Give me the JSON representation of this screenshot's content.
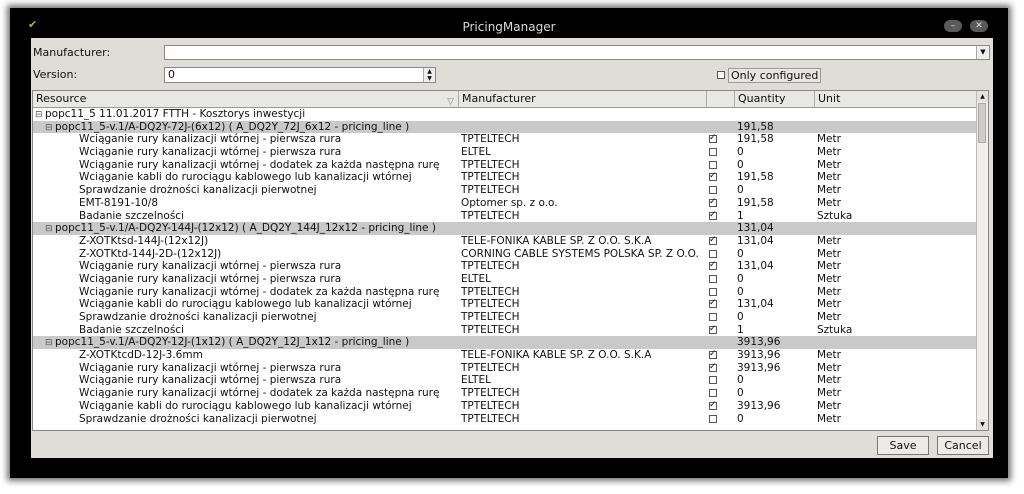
{
  "window": {
    "title": "PricingManager"
  },
  "form": {
    "manufacturer_label": "Manufacturer:",
    "manufacturer_value": "",
    "version_label": "Version:",
    "version_value": "0",
    "only_configured_label": "Only configured",
    "only_configured_checked": false
  },
  "table": {
    "columns": [
      "Resource",
      "Manufacturer",
      "",
      "Quantity",
      "Unit"
    ],
    "rows": [
      {
        "type": "root",
        "resource": "popc11_5  11.01.2017  FTTH - Kosztorys inwestycji",
        "manufacturer": "",
        "checked": null,
        "quantity": "",
        "unit": ""
      },
      {
        "type": "group",
        "resource": "popc11_5-v.1/A-DQ2Y-72J-(6x12)  ( A_DQ2Y_72J_6x12 - pricing_line )",
        "manufacturer": "",
        "checked": null,
        "quantity": "191,58",
        "unit": ""
      },
      {
        "type": "item",
        "resource": "Wciąganie rury kanalizacji wtórnej - pierwsza rura",
        "manufacturer": "TPTELTECH",
        "checked": true,
        "quantity": "191,58",
        "unit": "Metr"
      },
      {
        "type": "item",
        "resource": "Wciąganie rury kanalizacji wtórnej - pierwsza rura",
        "manufacturer": "ELTEL",
        "checked": false,
        "quantity": "0",
        "unit": "Metr"
      },
      {
        "type": "item",
        "resource": "Wciąganie rury kanalizacji wtórnej - dodatek za każda następna rurę",
        "manufacturer": "TPTELTECH",
        "checked": false,
        "quantity": "0",
        "unit": "Metr"
      },
      {
        "type": "item",
        "resource": "Wciąganie kabli do rurociągu kablowego lub kanalizacji wtórnej",
        "manufacturer": "TPTELTECH",
        "checked": true,
        "quantity": "191,58",
        "unit": "Metr"
      },
      {
        "type": "item",
        "resource": "Sprawdzanie drożności kanalizacji pierwotnej",
        "manufacturer": "TPTELTECH",
        "checked": false,
        "quantity": "0",
        "unit": "Metr"
      },
      {
        "type": "item",
        "resource": "EMT-8191-10/8",
        "manufacturer": "Optomer sp. z o.o.",
        "checked": true,
        "quantity": "191,58",
        "unit": "Metr"
      },
      {
        "type": "item",
        "resource": "Badanie szczelności",
        "manufacturer": "TPTELTECH",
        "checked": true,
        "quantity": "1",
        "unit": "Sztuka"
      },
      {
        "type": "group",
        "resource": "popc11_5-v.1/A-DQ2Y-144J-(12x12)  ( A_DQ2Y_144J_12x12 - pricing_line )",
        "manufacturer": "",
        "checked": null,
        "quantity": "131,04",
        "unit": ""
      },
      {
        "type": "item",
        "resource": "Z-XOTKtsd-144J-(12x12J)",
        "manufacturer": "TELE-FONIKA KABLE SP. Z O.O. S.K.A",
        "checked": true,
        "quantity": "131,04",
        "unit": "Metr"
      },
      {
        "type": "item",
        "resource": "Z-XOTKtd-144J-2D-(12x12J)",
        "manufacturer": "CORNING CABLE SYSTEMS POLSKA SP. Z O.O.",
        "checked": false,
        "quantity": "0",
        "unit": "Metr"
      },
      {
        "type": "item",
        "resource": "Wciąganie rury kanalizacji wtórnej - pierwsza rura",
        "manufacturer": "TPTELTECH",
        "checked": true,
        "quantity": "131,04",
        "unit": "Metr"
      },
      {
        "type": "item",
        "resource": "Wciąganie rury kanalizacji wtórnej - pierwsza rura",
        "manufacturer": "ELTEL",
        "checked": false,
        "quantity": "0",
        "unit": "Metr"
      },
      {
        "type": "item",
        "resource": "Wciąganie rury kanalizacji wtórnej - dodatek za każda następna rurę",
        "manufacturer": "TPTELTECH",
        "checked": false,
        "quantity": "0",
        "unit": "Metr"
      },
      {
        "type": "item",
        "resource": "Wciąganie kabli do rurociągu kablowego lub kanalizacji wtórnej",
        "manufacturer": "TPTELTECH",
        "checked": true,
        "quantity": "131,04",
        "unit": "Metr"
      },
      {
        "type": "item",
        "resource": "Sprawdzanie drożności kanalizacji pierwotnej",
        "manufacturer": "TPTELTECH",
        "checked": false,
        "quantity": "0",
        "unit": "Metr"
      },
      {
        "type": "item",
        "resource": "Badanie szczelności",
        "manufacturer": "TPTELTECH",
        "checked": true,
        "quantity": "1",
        "unit": "Sztuka"
      },
      {
        "type": "group",
        "resource": "popc11_5-v.1/A-DQ2Y-12J-(1x12)  ( A_DQ2Y_12J_1x12 - pricing_line )",
        "manufacturer": "",
        "checked": null,
        "quantity": "3913,96",
        "unit": ""
      },
      {
        "type": "item",
        "resource": "Z-XOTKtcdD-12J-3.6mm",
        "manufacturer": "TELE-FONIKA KABLE SP. Z O.O. S.K.A",
        "checked": true,
        "quantity": "3913,96",
        "unit": "Metr"
      },
      {
        "type": "item",
        "resource": "Wciąganie rury kanalizacji wtórnej - pierwsza rura",
        "manufacturer": "TPTELTECH",
        "checked": true,
        "quantity": "3913,96",
        "unit": "Metr"
      },
      {
        "type": "item",
        "resource": "Wciąganie rury kanalizacji wtórnej - pierwsza rura",
        "manufacturer": "ELTEL",
        "checked": false,
        "quantity": "0",
        "unit": "Metr"
      },
      {
        "type": "item",
        "resource": "Wciąganie rury kanalizacji wtórnej - dodatek za każda następna rurę",
        "manufacturer": "TPTELTECH",
        "checked": false,
        "quantity": "0",
        "unit": "Metr"
      },
      {
        "type": "item",
        "resource": "Wciąganie kabli do rurociągu kablowego lub kanalizacji wtórnej",
        "manufacturer": "TPTELTECH",
        "checked": true,
        "quantity": "3913,96",
        "unit": "Metr"
      },
      {
        "type": "item",
        "resource": "Sprawdzanie drożności kanalizacji pierwotnej",
        "manufacturer": "TPTELTECH",
        "checked": false,
        "quantity": "0",
        "unit": "Metr"
      }
    ]
  },
  "buttons": {
    "save": "Save",
    "cancel": "Cancel"
  }
}
